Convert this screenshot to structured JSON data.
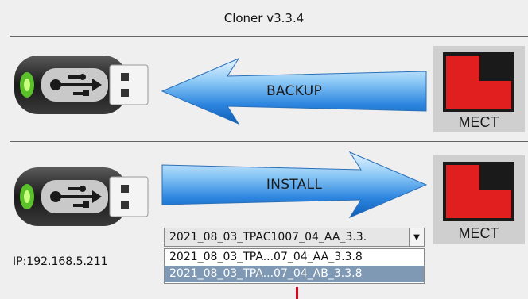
{
  "window": {
    "title": "Cloner v3.3.4"
  },
  "backup": {
    "label": "BACKUP"
  },
  "install": {
    "label": "INSTALL"
  },
  "brand": {
    "logo_text": "MECT",
    "logo_color": "#e11f1f"
  },
  "status": {
    "ip": "IP:192.168.5.211"
  },
  "version_select": {
    "selected": "2021_08_03_TPAC1007_04_AA_3.3.",
    "options": [
      "2021_08_03_TPA...07_04_AA_3.3.8",
      "2021_08_03_TPA...07_04_AB_3.3.8"
    ],
    "highlighted_index": 1
  },
  "icons": [
    "usb-drive-icon",
    "arrow-left-icon",
    "arrow-right-icon",
    "chevron-down-icon"
  ]
}
